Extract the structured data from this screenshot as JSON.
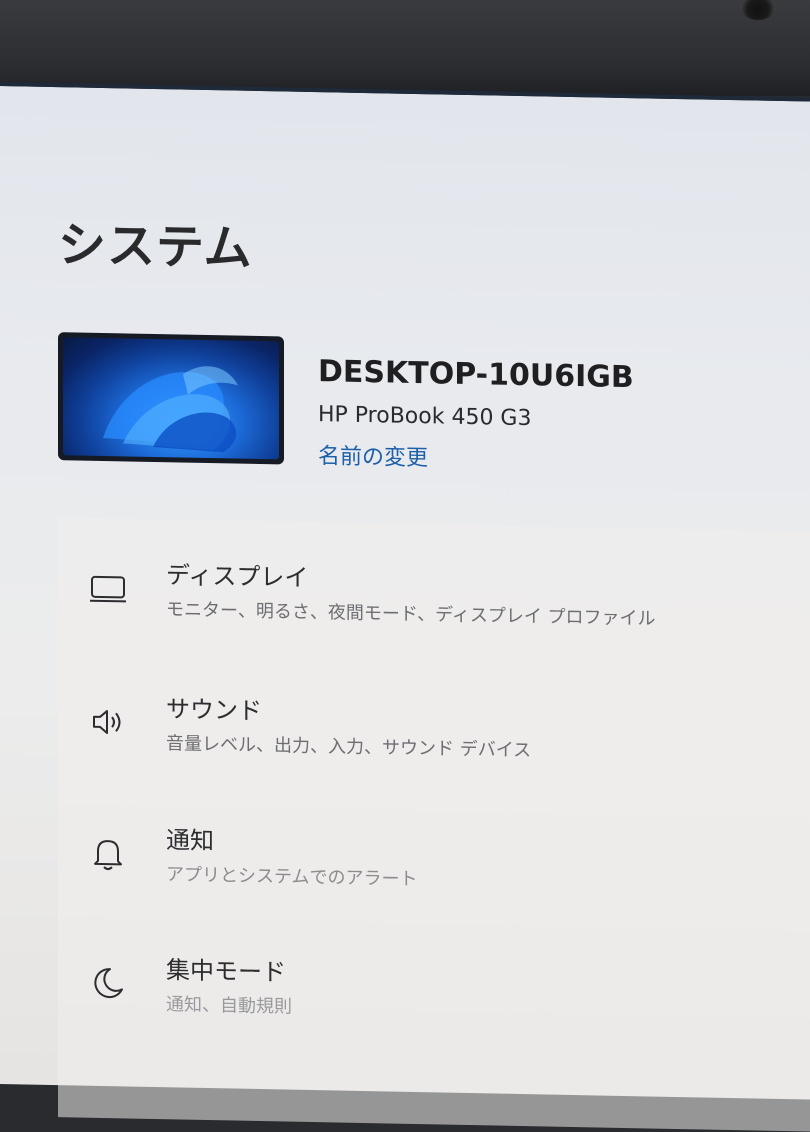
{
  "page": {
    "title": "システム"
  },
  "device": {
    "name": "DESKTOP-10U6IGB",
    "model": "HP ProBook 450 G3",
    "rename_label": "名前の変更"
  },
  "settings_items": [
    {
      "title": "ディスプレイ",
      "description": "モニター、明るさ、夜間モード、ディスプレイ プロファイル",
      "icon": "monitor-icon"
    },
    {
      "title": "サウンド",
      "description": "音量レベル、出力、入力、サウンド デバイス",
      "icon": "speaker-icon"
    },
    {
      "title": "通知",
      "description": "アプリとシステムでのアラート",
      "icon": "bell-icon"
    },
    {
      "title": "集中モード",
      "description": "通知、自動規則",
      "icon": "moon-icon"
    }
  ],
  "colors": {
    "link": "#1d5fa8",
    "title_text": "#2a2a2c",
    "secondary_text": "#6e6e72"
  }
}
